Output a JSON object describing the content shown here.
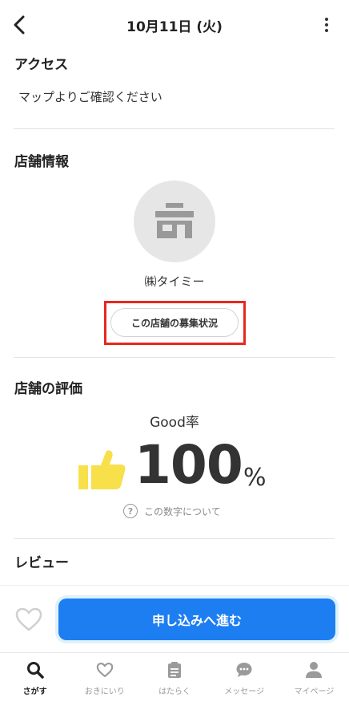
{
  "header": {
    "title": "10月11日 (火)",
    "back_icon": "chevron-left-icon",
    "more_icon": "more-vertical-icon"
  },
  "access": {
    "title": "アクセス",
    "text": "マップよりご確認ください"
  },
  "shop": {
    "title": "店舗情報",
    "avatar_icon": "store-icon",
    "name": "㈱タイミー",
    "recruit_button": "この店舗の募集状況"
  },
  "rating": {
    "title": "店舗の評価",
    "good_label": "Good率",
    "good_value": "100",
    "good_unit": "%",
    "thumb_icon": "thumbs-up-icon",
    "thumb_color": "#f7e04a",
    "about": "この数字について"
  },
  "review": {
    "title": "レビュー"
  },
  "action": {
    "apply_label": "申し込みへ進む",
    "apply_color": "#1d7ef2",
    "favorite_icon": "heart-icon"
  },
  "tabs": [
    {
      "label": "さがす",
      "icon": "search-icon",
      "active": true
    },
    {
      "label": "おきにいり",
      "icon": "heart-icon",
      "active": false
    },
    {
      "label": "はたらく",
      "icon": "clipboard-icon",
      "active": false
    },
    {
      "label": "メッセージ",
      "icon": "chat-icon",
      "active": false
    },
    {
      "label": "マイページ",
      "icon": "person-icon",
      "active": false
    }
  ]
}
